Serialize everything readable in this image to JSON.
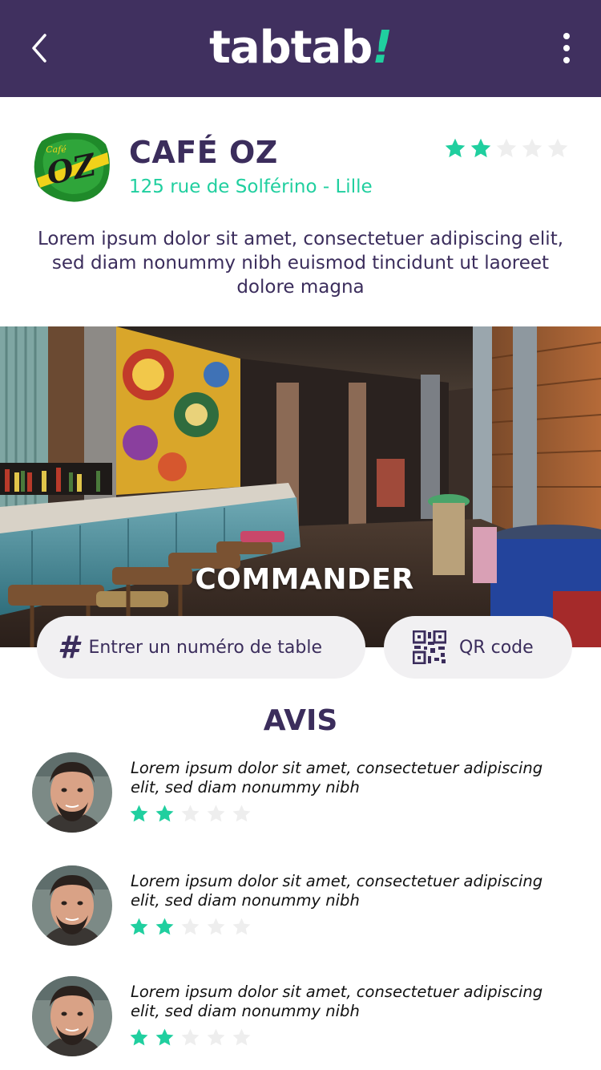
{
  "app": {
    "brand": "tabtab",
    "brand_mark": "!"
  },
  "header": {
    "back_icon": "chevron-left-icon",
    "menu_icon": "vertical-dots-icon"
  },
  "venue": {
    "name": "CAFÉ OZ",
    "address": "125 rue de Solférino - Lille",
    "rating": 2,
    "rating_max": 5,
    "logo_text": "OZ",
    "logo_small": "Café",
    "description": "Lorem ipsum dolor sit amet, consectetuer adipiscing elit, sed diam nonummy nibh euismod tincidunt ut laoreet dolore magna"
  },
  "order": {
    "title": "COMMANDER",
    "table_button": "Entrer un numéro de table",
    "table_icon": "hash-icon",
    "qr_button": "QR code",
    "qr_icon": "qr-code-icon"
  },
  "reviews": {
    "title": "AVIS",
    "items": [
      {
        "text": "Lorem ipsum dolor sit amet, consectetuer adipiscing elit, sed diam nonummy nibh",
        "rating": 2
      },
      {
        "text": "Lorem ipsum dolor sit amet, consectetuer adipiscing elit, sed diam nonummy nibh",
        "rating": 2
      },
      {
        "text": "Lorem ipsum dolor sit amet, consectetuer adipiscing elit, sed diam nonummy nibh",
        "rating": 2
      }
    ]
  },
  "colors": {
    "header_bg": "#40305f",
    "accent": "#20cf9f",
    "text": "#3b2d5c",
    "pill_bg": "#f1f0f2",
    "star_empty": "#eeeeee"
  }
}
